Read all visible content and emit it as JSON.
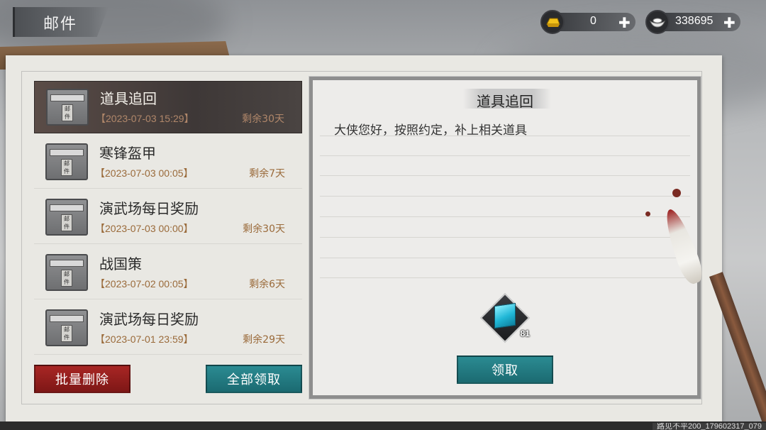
{
  "header": {
    "title": "邮件"
  },
  "currency": {
    "gold": {
      "icon": "gold-ingot-icon",
      "value": "0"
    },
    "silver": {
      "icon": "silver-ingot-icon",
      "value": "338695"
    }
  },
  "mail_list": [
    {
      "title": "道具追回",
      "date": "【2023-07-03 15:29】",
      "remaining": "剩余30天",
      "selected": true
    },
    {
      "title": "寒锋盔甲",
      "date": "【2023-07-03 00:05】",
      "remaining": "剩余7天",
      "selected": false
    },
    {
      "title": "演武场每日奖励",
      "date": "【2023-07-03 00:00】",
      "remaining": "剩余30天",
      "selected": false
    },
    {
      "title": "战国策",
      "date": "【2023-07-02 00:05】",
      "remaining": "剩余6天",
      "selected": false
    },
    {
      "title": "演武场每日奖励",
      "date": "【2023-07-01 23:59】",
      "remaining": "剩余29天",
      "selected": false
    }
  ],
  "envelope_seal": "邮件",
  "buttons": {
    "batch_delete": "批量删除",
    "claim_all": "全部领取",
    "claim": "领取"
  },
  "detail": {
    "title": "道具追回",
    "body": "大侠您好，按照约定，补上相关道具",
    "item": {
      "icon": "blue-cube-item-icon",
      "quantity": "81"
    }
  },
  "footer_text": "路见不平200_179602317_079",
  "colors": {
    "delete_red": "#a82624",
    "claim_teal": "#2b8b92",
    "date_brown": "#9a6a3a"
  }
}
